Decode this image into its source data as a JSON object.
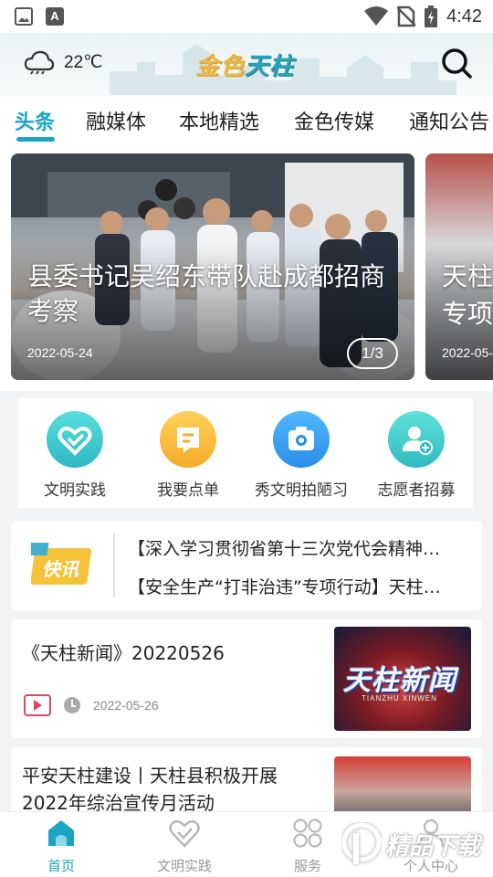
{
  "status_bar": {
    "time": "4:42",
    "icons": [
      "image-icon",
      "font-icon",
      "wifi-icon",
      "no-sim-icon",
      "battery-icon"
    ]
  },
  "header": {
    "weather_icon": "cloudy-icon",
    "temperature": "22℃",
    "logo_part1": "金色",
    "logo_part2": "天柱",
    "search_icon": "search-icon"
  },
  "tabs": [
    {
      "label": "头条",
      "active": true
    },
    {
      "label": "融媒体"
    },
    {
      "label": "本地精选"
    },
    {
      "label": "金色传媒"
    },
    {
      "label": "通知公告"
    }
  ],
  "carousel": {
    "slides": [
      {
        "title": "县委书记吴绍东带队赴成都招商考察",
        "date": "2022-05-24"
      },
      {
        "title_line1": "天柱",
        "title_line2": "专项",
        "date": "2022-05-"
      }
    ],
    "counter": "1/3"
  },
  "quick_links": [
    {
      "label": "文明实践",
      "icon": "heart-icon",
      "color": "#3ec9c9"
    },
    {
      "label": "我要点单",
      "icon": "order-icon",
      "color": "#f7b731"
    },
    {
      "label": "秀文明拍陋习",
      "icon": "camera-icon",
      "color": "#3b9ef0"
    },
    {
      "label": "志愿者招募",
      "icon": "volunteer-icon",
      "color": "#3fd0c8"
    }
  ],
  "flash_news": {
    "logo_text": "快讯",
    "lines": [
      "【深入学习贯彻省第十三次党代会精神…",
      "【安全生产“打非治违”专项行动】天柱…"
    ]
  },
  "news": [
    {
      "title": "《天柱新闻》20220526",
      "date": "2022-05-26",
      "thumb_text": "天柱新闻",
      "thumb_sub": "TIANZHU XINWEN"
    },
    {
      "title_line1": "平安天柱建设丨天柱县积极开展",
      "title_line2": "2022年综治宣传月活动"
    }
  ],
  "bottom_nav": [
    {
      "label": "首页",
      "icon": "home-icon",
      "active": true
    },
    {
      "label": "文明实践",
      "icon": "heart-icon"
    },
    {
      "label": "服务",
      "icon": "grid-icon"
    },
    {
      "label": "个人中心",
      "icon": "person-icon"
    }
  ],
  "watermark": "精品下载",
  "colors": {
    "accent": "#1ba5c2",
    "logo_gold": "#e9b94a"
  }
}
